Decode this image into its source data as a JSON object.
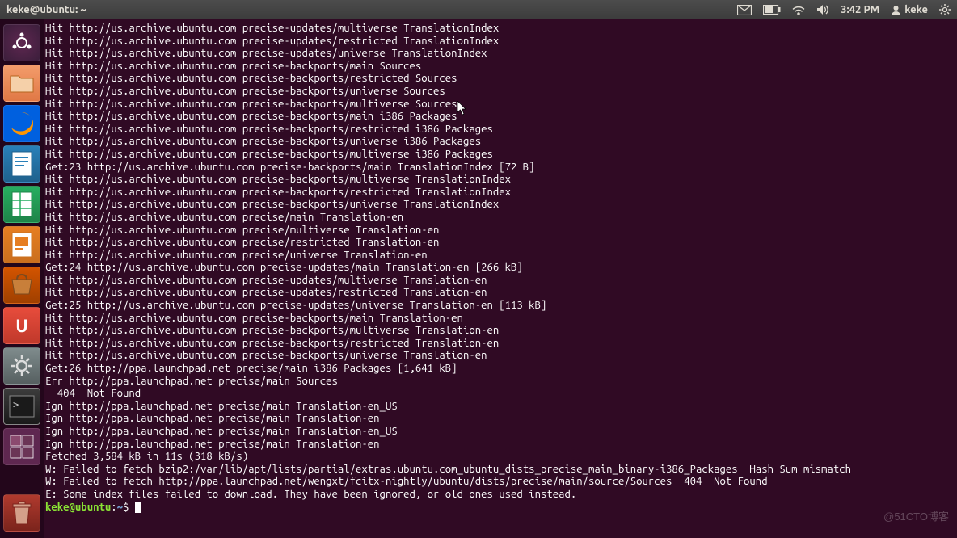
{
  "top_panel": {
    "title": "keke@ubuntu: ~",
    "time": "3:42 PM",
    "user": "keke"
  },
  "launcher": {
    "items": [
      {
        "name": "dash",
        "label": ""
      },
      {
        "name": "files",
        "label": ""
      },
      {
        "name": "firefox",
        "label": ""
      },
      {
        "name": "writer",
        "label": ""
      },
      {
        "name": "calc",
        "label": ""
      },
      {
        "name": "impress",
        "label": ""
      },
      {
        "name": "software-center",
        "label": ""
      },
      {
        "name": "ubuntu-one",
        "label": "U"
      },
      {
        "name": "settings",
        "label": ""
      },
      {
        "name": "terminal",
        "label": ">_"
      },
      {
        "name": "workspace",
        "label": ""
      }
    ],
    "trash_label": ""
  },
  "terminal": {
    "lines": [
      "Hit http://us.archive.ubuntu.com precise-updates/multiverse TranslationIndex",
      "Hit http://us.archive.ubuntu.com precise-updates/restricted TranslationIndex",
      "Hit http://us.archive.ubuntu.com precise-updates/universe TranslationIndex",
      "Hit http://us.archive.ubuntu.com precise-backports/main Sources",
      "Hit http://us.archive.ubuntu.com precise-backports/restricted Sources",
      "Hit http://us.archive.ubuntu.com precise-backports/universe Sources",
      "Hit http://us.archive.ubuntu.com precise-backports/multiverse Sources",
      "Hit http://us.archive.ubuntu.com precise-backports/main i386 Packages",
      "Hit http://us.archive.ubuntu.com precise-backports/restricted i386 Packages",
      "Hit http://us.archive.ubuntu.com precise-backports/universe i386 Packages",
      "Hit http://us.archive.ubuntu.com precise-backports/multiverse i386 Packages",
      "Get:23 http://us.archive.ubuntu.com precise-backports/main TranslationIndex [72 B]",
      "Hit http://us.archive.ubuntu.com precise-backports/multiverse TranslationIndex",
      "Hit http://us.archive.ubuntu.com precise-backports/restricted TranslationIndex",
      "Hit http://us.archive.ubuntu.com precise-backports/universe TranslationIndex",
      "Hit http://us.archive.ubuntu.com precise/main Translation-en",
      "Hit http://us.archive.ubuntu.com precise/multiverse Translation-en",
      "Hit http://us.archive.ubuntu.com precise/restricted Translation-en",
      "Hit http://us.archive.ubuntu.com precise/universe Translation-en",
      "Get:24 http://us.archive.ubuntu.com precise-updates/main Translation-en [266 kB]",
      "Hit http://us.archive.ubuntu.com precise-updates/multiverse Translation-en",
      "Hit http://us.archive.ubuntu.com precise-updates/restricted Translation-en",
      "Get:25 http://us.archive.ubuntu.com precise-updates/universe Translation-en [113 kB]",
      "Hit http://us.archive.ubuntu.com precise-backports/main Translation-en",
      "Hit http://us.archive.ubuntu.com precise-backports/multiverse Translation-en",
      "Hit http://us.archive.ubuntu.com precise-backports/restricted Translation-en",
      "Hit http://us.archive.ubuntu.com precise-backports/universe Translation-en",
      "Get:26 http://ppa.launchpad.net precise/main i386 Packages [1,641 kB]",
      "Err http://ppa.launchpad.net precise/main Sources",
      "  404  Not Found",
      "Ign http://ppa.launchpad.net precise/main Translation-en_US",
      "Ign http://ppa.launchpad.net precise/main Translation-en",
      "Ign http://ppa.launchpad.net precise/main Translation-en_US",
      "Ign http://ppa.launchpad.net precise/main Translation-en",
      "Fetched 3,584 kB in 11s (318 kB/s)",
      "W: Failed to fetch bzip2:/var/lib/apt/lists/partial/extras.ubuntu.com_ubuntu_dists_precise_main_binary-i386_Packages  Hash Sum mismatch",
      "",
      "W: Failed to fetch http://ppa.launchpad.net/wengxt/fcitx-nightly/ubuntu/dists/precise/main/source/Sources  404  Not Found",
      "",
      "E: Some index files failed to download. They have been ignored, or old ones used instead."
    ],
    "prompt_user": "keke@ubuntu",
    "prompt_sep": ":",
    "prompt_path": "~",
    "prompt_end": "$ "
  },
  "watermark": "@51CTO博客"
}
